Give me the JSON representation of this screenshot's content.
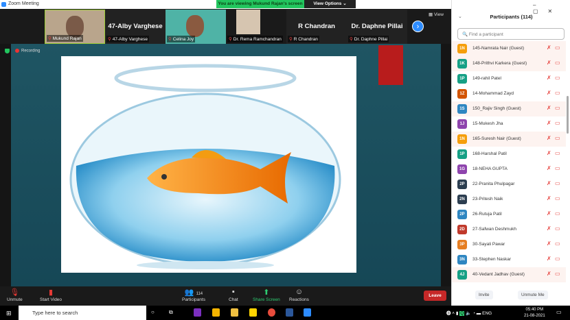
{
  "window": {
    "title": "Zoom Meeting",
    "banner": "You are viewing Mukund Rajan's screen",
    "view_options": "View Options ⌄",
    "view": "View"
  },
  "thumbnails": [
    {
      "name": "Mukund Rajan",
      "big": ""
    },
    {
      "name": "47-Alby Varghese",
      "big": "47-Alby Varghese"
    },
    {
      "name": "Celina Joy",
      "big": ""
    },
    {
      "name": "Dr. Rema Ramchandran",
      "big": ""
    },
    {
      "name": "R Chandran",
      "big": "R Chandran"
    },
    {
      "name": "Dr. Daphne Pillai",
      "big": "Dr. Daphne Pillai"
    }
  ],
  "share": {
    "recording": "Recording"
  },
  "toolbar": {
    "unmute": "Unmute",
    "start_video": "Start Video",
    "participants": "Participants",
    "participant_count": "114",
    "chat": "Chat",
    "share_screen": "Share Screen",
    "reactions": "Reactions",
    "leave": "Leave"
  },
  "panel": {
    "title": "Participants (114)",
    "search_placeholder": "Find a participant",
    "invite": "Invite",
    "unmute_me": "Unmute Me",
    "participants": [
      {
        "initials": "1N",
        "name": "145-Namrata Nair (Guest)",
        "color": "#f59e0b",
        "guest": true
      },
      {
        "initials": "1K",
        "name": "148-Prithvi Karkera (Guest)",
        "color": "#16a085",
        "guest": true
      },
      {
        "initials": "1P",
        "name": "149-rahil Patel",
        "color": "#16a085",
        "guest": false
      },
      {
        "initials": "1Z",
        "name": "14-Mohammad Zayd",
        "color": "#d35400",
        "guest": false
      },
      {
        "initials": "1S",
        "name": "150_Rajiv Singh (Guest)",
        "color": "#2e86c1",
        "guest": true
      },
      {
        "initials": "1J",
        "name": "15-Mukesh Jha",
        "color": "#8e44ad",
        "guest": false
      },
      {
        "initials": "1N",
        "name": "165-Suresh Nair (Guest)",
        "color": "#f59e0b",
        "guest": true
      },
      {
        "initials": "1P",
        "name": "168-Harshal Patil",
        "color": "#16a085",
        "guest": false
      },
      {
        "initials": "1G",
        "name": "18-NEHA GUPTA",
        "color": "#8e44ad",
        "guest": false
      },
      {
        "initials": "2P",
        "name": "22-Pranita Phulpagar",
        "color": "#2c3e50",
        "guest": false
      },
      {
        "initials": "2N",
        "name": "23-Pritesh Naik",
        "color": "#2c3e50",
        "guest": false
      },
      {
        "initials": "2P",
        "name": "26-Rutuja Patil",
        "color": "#2e86c1",
        "guest": false
      },
      {
        "initials": "2D",
        "name": "27-Safwan Deshmukh",
        "color": "#c0392b",
        "guest": false
      },
      {
        "initials": "3P",
        "name": "30-Sayali Pawar",
        "color": "#e67e22",
        "guest": false
      },
      {
        "initials": "3N",
        "name": "33-Stephen Naskar",
        "color": "#2e86c1",
        "guest": false
      },
      {
        "initials": "4J",
        "name": "40-Vedant Jadhav (Guest)",
        "color": "#16a085",
        "guest": true
      }
    ]
  },
  "taskbar": {
    "search_placeholder": "Type here to search",
    "lang": "ENG",
    "time": "05:40 PM",
    "date": "21-08-2021"
  }
}
